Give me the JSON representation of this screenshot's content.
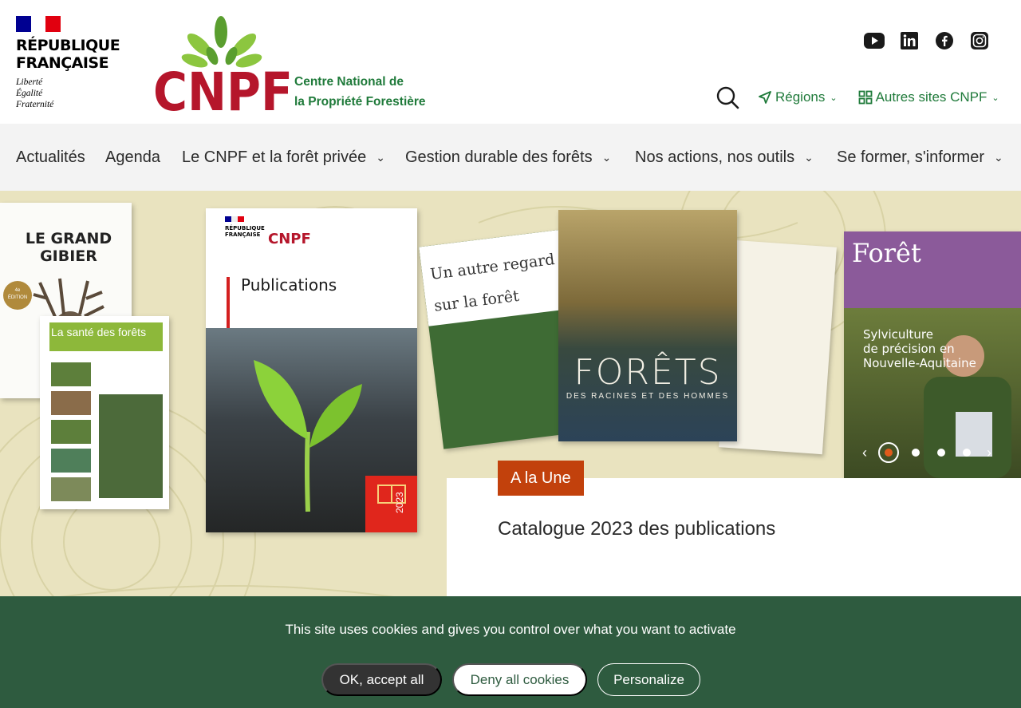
{
  "header": {
    "marianne": {
      "title": "RÉPUBLIQUE\nFRANÇAISE",
      "motto": "Liberté\nÉgalité\nFraternité",
      "flag_colors": [
        "#000091",
        "#ffffff",
        "#e1000f"
      ]
    },
    "logo": {
      "wordmark": "CNPF",
      "name": "Centre National de\nla Propriété Forestière",
      "colors": {
        "wordmark": "#b5162b",
        "leaves": "#8cc63f",
        "leaves_dark": "#5a9e2f",
        "name": "#1f7a3a"
      }
    },
    "social": [
      {
        "icon": "youtube-icon",
        "label": "YouTube"
      },
      {
        "icon": "linkedin-icon",
        "label": "LinkedIn"
      },
      {
        "icon": "facebook-icon",
        "label": "Facebook"
      },
      {
        "icon": "instagram-icon",
        "label": "Instagram"
      }
    ],
    "tools": {
      "search_icon": "search-icon",
      "regions": "Régions",
      "autres_sites": "Autres sites CNPF"
    }
  },
  "nav": {
    "items": [
      {
        "label": "Actualités",
        "dropdown": false
      },
      {
        "label": "Agenda",
        "dropdown": false
      },
      {
        "label": "Le CNPF et la forêt privée",
        "dropdown": true
      },
      {
        "label": "Gestion durable des forêts",
        "dropdown": true
      },
      {
        "label": "Nos actions, nos outils",
        "dropdown": true
      },
      {
        "label": "Se former, s'informer",
        "dropdown": true
      }
    ]
  },
  "hero": {
    "books": {
      "gibier": "LE GRAND GIBIER",
      "sante": "La santé des forêts",
      "publications": "Publications",
      "publications_year": "2023",
      "regard": "Un autre regard sur la forêt",
      "forets_title": "FORÊTS",
      "forets_subtitle": "DES RACINES ET DES HOMMES",
      "innov_title": "Forêt",
      "innov_sub": "Sylviculture\nde précision en\nNouvelle-Aquitaine"
    },
    "badge": "A la Une",
    "title": "Catalogue 2023 des publications",
    "carousel": {
      "active": 1,
      "count": 4
    }
  },
  "cookie": {
    "text": "This site uses cookies and gives you control over what you want to activate",
    "accept": "OK, accept all",
    "deny": "Deny all cookies",
    "personalize": "Personalize"
  },
  "colors": {
    "green": "#1f7a3a",
    "cookie_bg": "#2e5b3f",
    "badge": "#c2410c",
    "nav_bg": "#f3f3f3"
  }
}
